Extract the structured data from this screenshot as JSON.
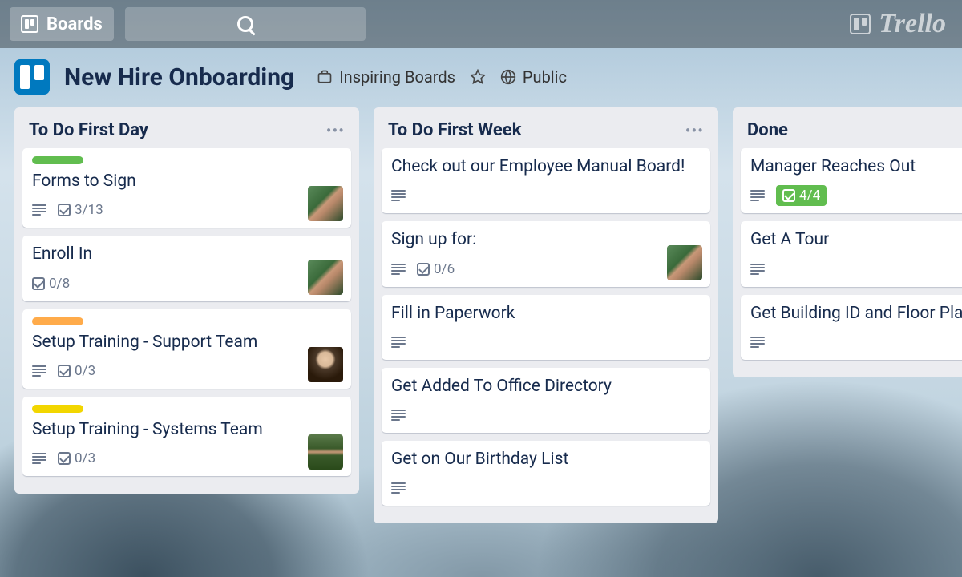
{
  "topbar": {
    "boards_label": "Boards",
    "brand": "Trello"
  },
  "board": {
    "title": "New Hire Onboarding",
    "org_label": "Inspiring Boards",
    "visibility": "Public"
  },
  "lists": [
    {
      "title": "To Do First Day",
      "cards": [
        {
          "label_color": "#61bd4f",
          "title": "Forms to Sign",
          "has_desc": true,
          "checklist": "3/13",
          "avatar": "av1"
        },
        {
          "title": "Enroll In",
          "checklist": "0/8",
          "avatar": "av1"
        },
        {
          "label_color": "#ffab4a",
          "title": "Setup Training - Support Team",
          "has_desc": true,
          "checklist": "0/3",
          "avatar": "av2"
        },
        {
          "label_color": "#f2d600",
          "title": "Setup Training - Systems Team",
          "has_desc": true,
          "checklist": "0/3",
          "avatar": "av3"
        }
      ]
    },
    {
      "title": "To Do First Week",
      "cards": [
        {
          "title": "Check out our Employee Manual Board!",
          "has_desc": true
        },
        {
          "title": "Sign up for:",
          "has_desc": true,
          "checklist": "0/6",
          "avatar": "av1"
        },
        {
          "title": "Fill in Paperwork",
          "has_desc": true
        },
        {
          "title": "Get Added To Office Directory",
          "has_desc": true
        },
        {
          "title": "Get on Our Birthday List",
          "has_desc": true
        }
      ]
    },
    {
      "title": "Done",
      "cards": [
        {
          "title": "Manager Reaches Out",
          "has_desc": true,
          "checklist": "4/4",
          "checklist_complete": true
        },
        {
          "title": "Get A Tour",
          "has_desc": true
        },
        {
          "title": "Get Building ID and Floor Plan",
          "has_desc": true
        }
      ]
    }
  ]
}
